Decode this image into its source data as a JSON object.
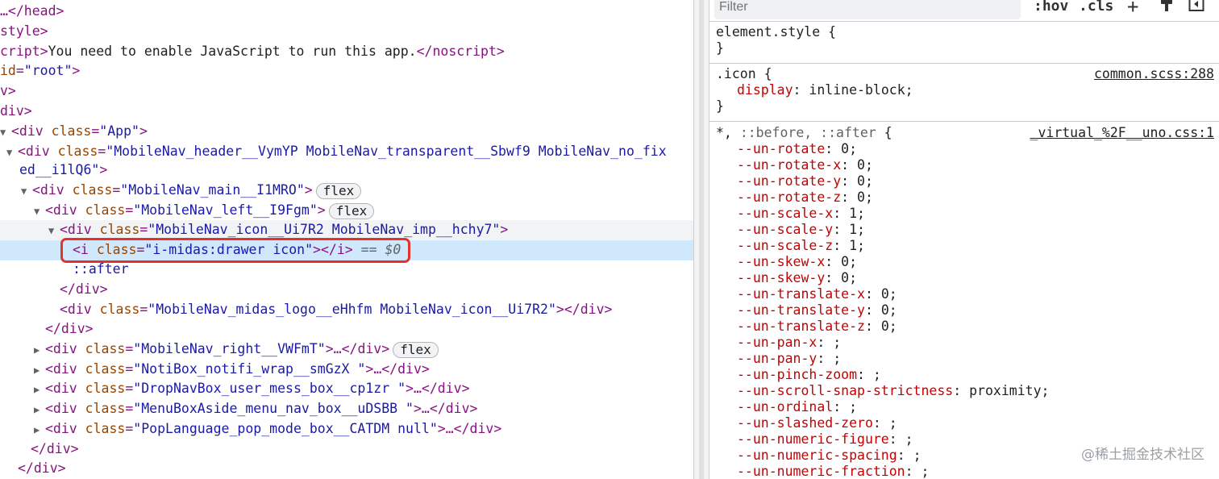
{
  "elements": {
    "rows": [
      {
        "t": "…</head>"
      },
      {
        "t": "style>"
      },
      {
        "t": "cript>You need to enable JavaScript to run this app.</noscript>"
      },
      {
        "t": " id=\"root\">"
      },
      {
        "t": "v>"
      },
      {
        "t": "div>"
      }
    ],
    "app_open": "<div class=\"App\">",
    "header_line1_a": "<div ",
    "header_attr": "class",
    "header_val_line1": "\"MobileNav_header__VymYP MobileNav_transparent__Sbwf9 MobileNav_no_fix",
    "header_val_line2": "ed__i1lQ6\"",
    "main_val": "\"MobileNav_main__I1MRO\"",
    "left_val": "\"MobileNav_left__I9Fgm\"",
    "icon_val": "\"MobileNav_icon__Ui7R2 MobileNav_imp__hchy7\"",
    "i_val": "\"i-midas:drawer icon\"",
    "eq_text": "== $0",
    "after_text": "::after",
    "close_div": "</div>",
    "logo_val": "\"MobileNav_midas_logo__eHhfm MobileNav_icon__Ui7R2\"",
    "right_val": "\"MobileNav_right__VWFmT\"",
    "noti_val": "\"NotiBox_notifi_wrap__smGzX \"",
    "drop_val": "\"DropNavBox_user_mess_box__cp1zr \"",
    "menu_val": "\"MenuBoxAside_menu_nav_box__uDSBB \"",
    "lang_val": "\"PopLanguage_pop_mode_box__CATDM null\"",
    "badge_flex": "flex",
    "ellipsis_close": "…</div>"
  },
  "styles": {
    "filter_placeholder": "Filter",
    "hov": ":hov",
    "cls": ".cls",
    "plus": "+",
    "element_style": "element.style {",
    "close_brace": "}",
    "icon_rule": {
      "selector": ".icon {",
      "source": "common.scss:288",
      "props": [
        {
          "n": "display",
          "v": "inline-block;"
        }
      ]
    },
    "uno_rule": {
      "selector_a": "*, ",
      "selector_b": "::before, ::after",
      "brace": " {",
      "source": "_virtual_%2F__uno.css:1",
      "props": [
        {
          "n": "--un-rotate",
          "v": "0;"
        },
        {
          "n": "--un-rotate-x",
          "v": "0;"
        },
        {
          "n": "--un-rotate-y",
          "v": "0;"
        },
        {
          "n": "--un-rotate-z",
          "v": "0;"
        },
        {
          "n": "--un-scale-x",
          "v": "1;"
        },
        {
          "n": "--un-scale-y",
          "v": "1;"
        },
        {
          "n": "--un-scale-z",
          "v": "1;"
        },
        {
          "n": "--un-skew-x",
          "v": "0;"
        },
        {
          "n": "--un-skew-y",
          "v": "0;"
        },
        {
          "n": "--un-translate-x",
          "v": "0;"
        },
        {
          "n": "--un-translate-y",
          "v": "0;"
        },
        {
          "n": "--un-translate-z",
          "v": "0;"
        },
        {
          "n": "--un-pan-x",
          "v": ";"
        },
        {
          "n": "--un-pan-y",
          "v": ";"
        },
        {
          "n": "--un-pinch-zoom",
          "v": ";"
        },
        {
          "n": "--un-scroll-snap-strictness",
          "v": "proximity;"
        },
        {
          "n": "--un-ordinal",
          "v": ";"
        },
        {
          "n": "--un-slashed-zero",
          "v": ";"
        },
        {
          "n": "--un-numeric-figure",
          "v": ";"
        },
        {
          "n": "--un-numeric-spacing",
          "v": ";"
        },
        {
          "n": "--un-numeric-fraction",
          "v": ";"
        }
      ]
    },
    "watermark": "@稀土掘金技术社区"
  },
  "colors": {
    "highlight_border": "#e3322b",
    "selected_row": "#cfe8fc",
    "prop_name": "#c80000"
  }
}
